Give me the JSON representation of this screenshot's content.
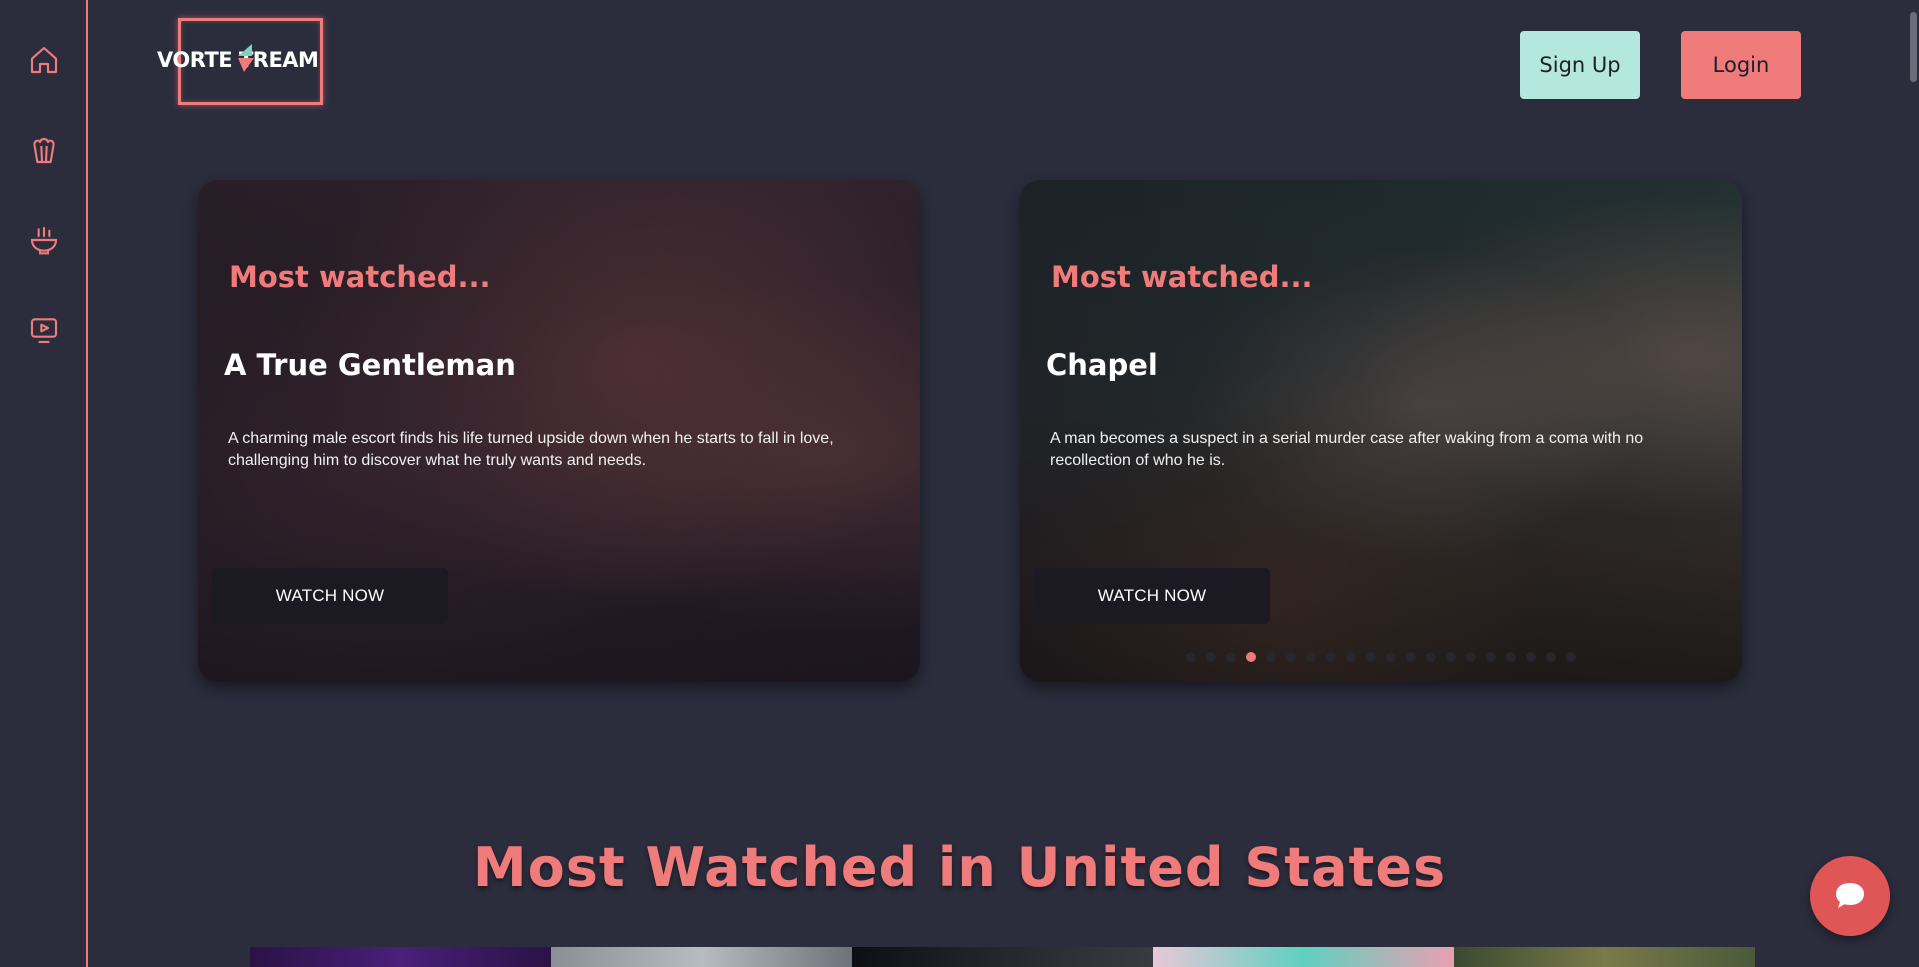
{
  "sidebar": {
    "items": [
      {
        "icon": "home-icon"
      },
      {
        "icon": "popcorn-icon"
      },
      {
        "icon": "noodle-bowl-icon"
      },
      {
        "icon": "tv-play-icon"
      }
    ]
  },
  "header": {
    "logo_text": "VORTE   TREAM",
    "signup_label": "Sign Up",
    "login_label": "Login"
  },
  "carousel": {
    "slides": [
      {
        "kicker": "Most watched...",
        "title": "A True Gentleman",
        "description": "A charming male escort finds his life turned upside down when he starts to fall in love, challenging him to discover what he truly wants and needs.",
        "button": "WATCH NOW"
      },
      {
        "kicker": "Most watched...",
        "title": "Chapel",
        "description": "A man becomes a suspect in a serial murder case after waking from a coma with no recollection of who he is.",
        "button": "WATCH NOW"
      }
    ],
    "dot_count": 20,
    "active_dot": 3
  },
  "section": {
    "title": "Most Watched in United States"
  },
  "colors": {
    "background": "#2b2d3d",
    "accent": "#ef7b7b",
    "signup": "#b4e8de",
    "chat": "#e05656"
  }
}
